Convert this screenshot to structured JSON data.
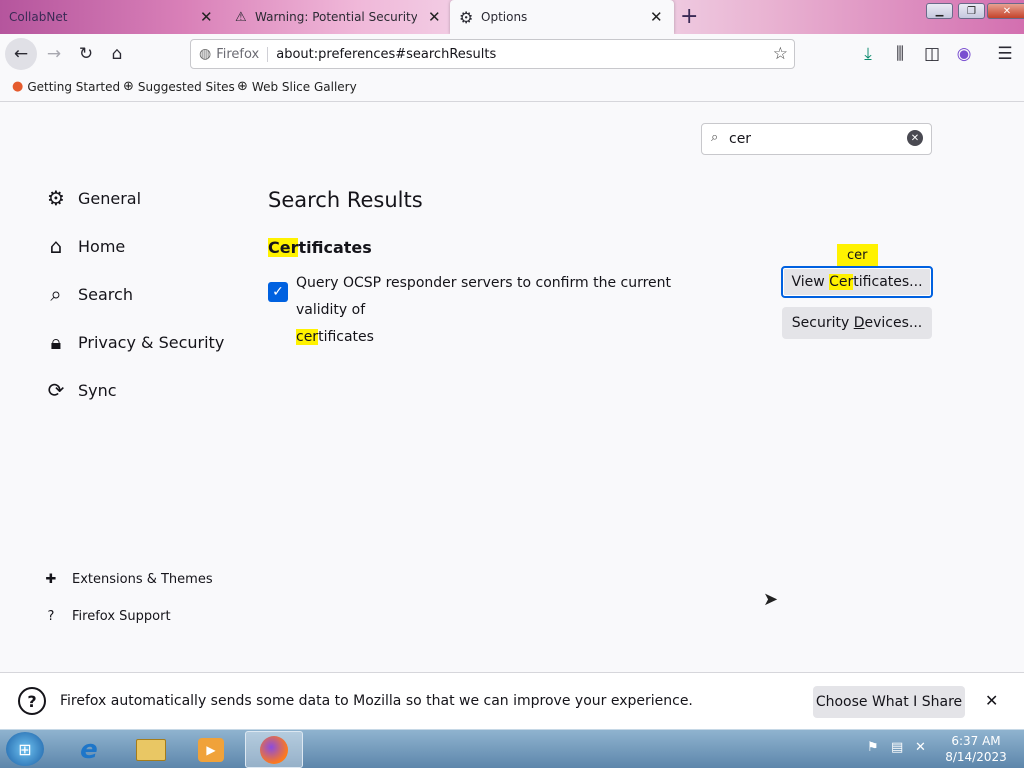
{
  "tabs": [
    {
      "title": "CollabNet"
    },
    {
      "title": "Warning: Potential Security Risk Ahead"
    },
    {
      "title": "Options"
    }
  ],
  "nav": {
    "identity": "Firefox",
    "url": "about:preferences#searchResults"
  },
  "bookmarks": [
    {
      "label": "Getting Started"
    },
    {
      "label": "Suggested Sites"
    },
    {
      "label": "Web Slice Gallery"
    }
  ],
  "prefs": {
    "search_value": "cer",
    "categories": [
      {
        "label": "General"
      },
      {
        "label": "Home"
      },
      {
        "label": "Search"
      },
      {
        "label": "Privacy & Security"
      },
      {
        "label": "Sync"
      }
    ],
    "footer_links": [
      {
        "label": "Extensions & Themes"
      },
      {
        "label": "Firefox Support"
      }
    ],
    "results_title": "Search Results",
    "section": {
      "highlight": "Cer",
      "rest": "tificates"
    },
    "ocsp": {
      "line1": "Query OCSP responder servers to confirm the current validity of",
      "line2_hl": "cer",
      "line2_rest": "tificates",
      "checked": true
    },
    "tooltip": "cer",
    "view_cert": {
      "pre": "View ",
      "hl": "Cer",
      "post": "tificates..."
    },
    "security_devices": {
      "pre": "Security ",
      "underline": "D",
      "post": "evices..."
    }
  },
  "notice": {
    "text": "Firefox automatically sends some data to Mozilla so that we can improve your experience.",
    "button": "Choose What I Share"
  },
  "taskbar": {
    "time": "6:37 AM",
    "date": "8/14/2023"
  },
  "colors": {
    "accent": "#0061e0",
    "highlight": "#fff200",
    "tab_gradient": "#d980b8"
  }
}
